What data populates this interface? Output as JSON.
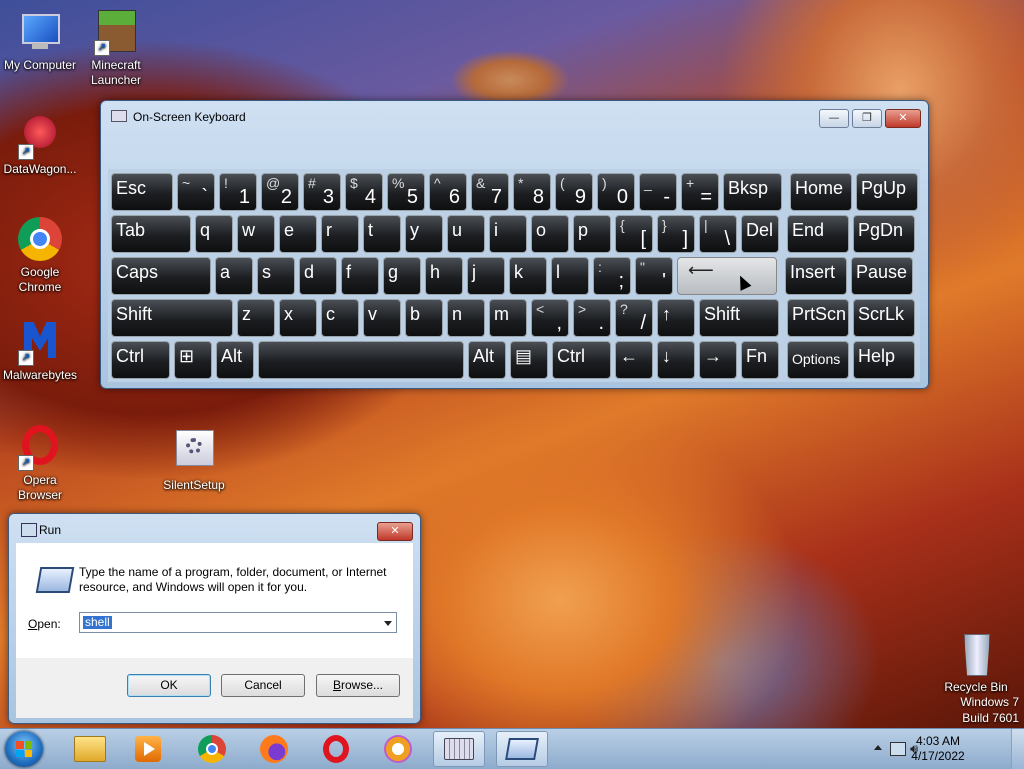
{
  "desktop": {
    "icons": [
      {
        "label": "My Computer"
      },
      {
        "label": "Minecraft Launcher"
      },
      {
        "label": "DataWagon..."
      },
      {
        "label": "Google Chrome"
      },
      {
        "label": "Malwarebytes"
      },
      {
        "label": "Opera Browser"
      },
      {
        "label": "SilentSetup"
      },
      {
        "label": "Recycle Bin"
      }
    ],
    "watermark": {
      "line1": "Windows 7",
      "line2": "Build 7601"
    }
  },
  "osk": {
    "title": "On-Screen Keyboard",
    "minimize": "—",
    "restore": "❐",
    "close": "✕",
    "rows": [
      [
        {
          "type": "label",
          "text": "Esc"
        },
        {
          "type": "dual",
          "top": "~",
          "bot": "`"
        },
        {
          "type": "dual",
          "top": "!",
          "bot": "1"
        },
        {
          "type": "dual",
          "top": "@",
          "bot": "2"
        },
        {
          "type": "dual",
          "top": "#",
          "bot": "3"
        },
        {
          "type": "dual",
          "top": "$",
          "bot": "4"
        },
        {
          "type": "dual",
          "top": "%",
          "bot": "5"
        },
        {
          "type": "dual",
          "top": "^",
          "bot": "6"
        },
        {
          "type": "dual",
          "top": "&",
          "bot": "7"
        },
        {
          "type": "dual",
          "top": "*",
          "bot": "8"
        },
        {
          "type": "dual",
          "top": "(",
          "bot": "9"
        },
        {
          "type": "dual",
          "top": ")",
          "bot": "0"
        },
        {
          "type": "dual",
          "top": "_",
          "bot": "-"
        },
        {
          "type": "dual",
          "top": "+",
          "bot": "="
        },
        {
          "type": "label",
          "text": "Bksp"
        },
        {
          "type": "label",
          "text": "Home"
        },
        {
          "type": "label",
          "text": "PgUp"
        }
      ],
      [
        {
          "type": "label",
          "text": "Tab"
        },
        {
          "type": "label",
          "text": "q"
        },
        {
          "type": "label",
          "text": "w"
        },
        {
          "type": "label",
          "text": "e"
        },
        {
          "type": "label",
          "text": "r"
        },
        {
          "type": "label",
          "text": "t"
        },
        {
          "type": "label",
          "text": "y"
        },
        {
          "type": "label",
          "text": "u"
        },
        {
          "type": "label",
          "text": "i"
        },
        {
          "type": "label",
          "text": "o"
        },
        {
          "type": "label",
          "text": "p"
        },
        {
          "type": "dual",
          "top": "{",
          "bot": "["
        },
        {
          "type": "dual",
          "top": "}",
          "bot": "]"
        },
        {
          "type": "dual",
          "top": "|",
          "bot": "\\"
        },
        {
          "type": "label",
          "text": "Del"
        },
        {
          "type": "label",
          "text": "End"
        },
        {
          "type": "label",
          "text": "PgDn"
        }
      ],
      [
        {
          "type": "label",
          "text": "Caps"
        },
        {
          "type": "label",
          "text": "a"
        },
        {
          "type": "label",
          "text": "s"
        },
        {
          "type": "label",
          "text": "d"
        },
        {
          "type": "label",
          "text": "f"
        },
        {
          "type": "label",
          "text": "g"
        },
        {
          "type": "label",
          "text": "h"
        },
        {
          "type": "label",
          "text": "j"
        },
        {
          "type": "label",
          "text": "k"
        },
        {
          "type": "label",
          "text": "l"
        },
        {
          "type": "dual",
          "top": ":",
          "bot": ";"
        },
        {
          "type": "dual",
          "top": "\"",
          "bot": "'"
        },
        {
          "type": "enter",
          "text": "⟵"
        },
        {
          "type": "label",
          "text": "Insert"
        },
        {
          "type": "label",
          "text": "Pause"
        }
      ],
      [
        {
          "type": "label",
          "text": "Shift"
        },
        {
          "type": "label",
          "text": "z"
        },
        {
          "type": "label",
          "text": "x"
        },
        {
          "type": "label",
          "text": "c"
        },
        {
          "type": "label",
          "text": "v"
        },
        {
          "type": "label",
          "text": "b"
        },
        {
          "type": "label",
          "text": "n"
        },
        {
          "type": "label",
          "text": "m"
        },
        {
          "type": "dual",
          "top": "<",
          "bot": ","
        },
        {
          "type": "dual",
          "top": ">",
          "bot": "."
        },
        {
          "type": "dual",
          "top": "?",
          "bot": "/"
        },
        {
          "type": "label",
          "text": "↑"
        },
        {
          "type": "label",
          "text": "Shift"
        },
        {
          "type": "label",
          "text": "PrtScn"
        },
        {
          "type": "label",
          "text": "ScrLk"
        }
      ],
      [
        {
          "type": "label",
          "text": "Ctrl"
        },
        {
          "type": "label",
          "text": "⊞"
        },
        {
          "type": "label",
          "text": "Alt"
        },
        {
          "type": "label",
          "text": ""
        },
        {
          "type": "label",
          "text": "Alt"
        },
        {
          "type": "label",
          "text": "▤"
        },
        {
          "type": "label",
          "text": "Ctrl"
        },
        {
          "type": "label",
          "text": "←"
        },
        {
          "type": "label",
          "text": "↓"
        },
        {
          "type": "label",
          "text": "→"
        },
        {
          "type": "label",
          "text": "Fn"
        },
        {
          "type": "label",
          "text": "Options"
        },
        {
          "type": "label",
          "text": "Help"
        }
      ]
    ]
  },
  "run": {
    "title": "Run",
    "close": "✕",
    "description": "Type the name of a program, folder, document, or Internet resource, and Windows will open it for you.",
    "open_label_pre": "",
    "open_label_u": "O",
    "open_label_post": "pen:",
    "open_value": "shell",
    "ok": "OK",
    "cancel": "Cancel",
    "browse_pre": "",
    "browse_u": "B",
    "browse_post": "rowse..."
  },
  "taskbar": {
    "time": "4:03 AM",
    "date": "4/17/2022"
  }
}
